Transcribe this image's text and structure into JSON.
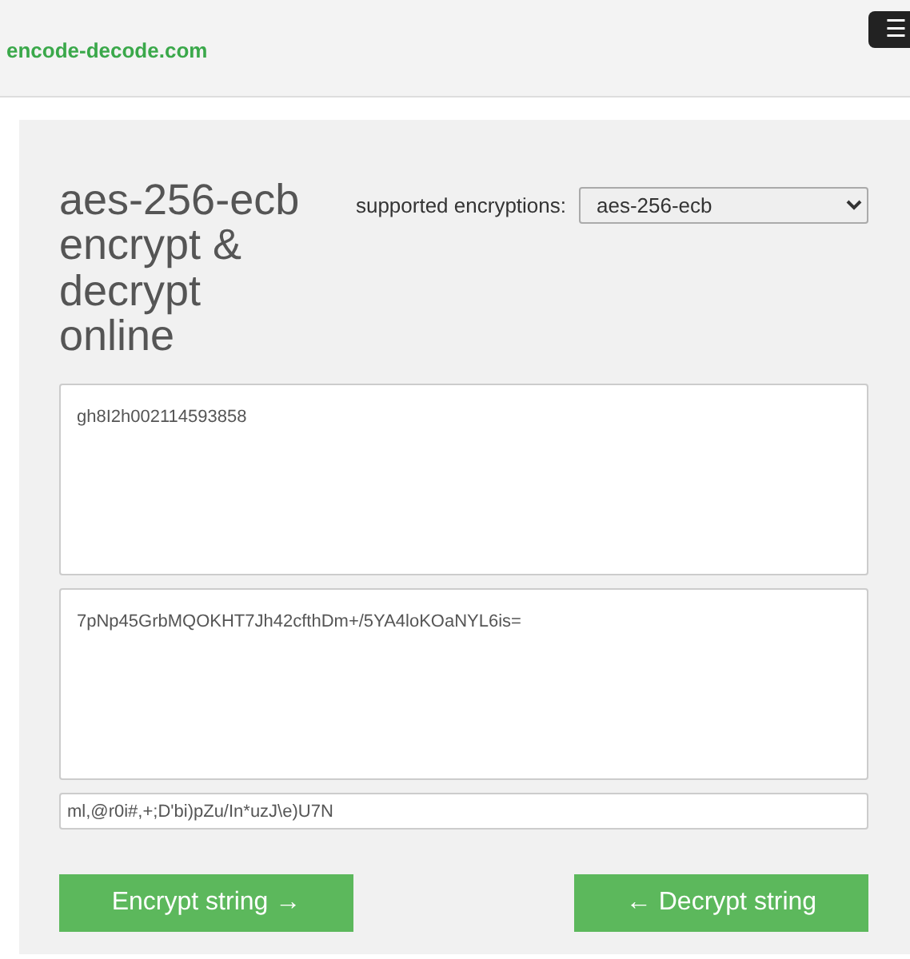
{
  "navbar": {
    "brand": "encode-decode.com",
    "menu_button": "☰"
  },
  "title": "aes-256-ecb encrypt & decrypt online",
  "encryption_select": {
    "label": "supported encryptions:",
    "value": "aes-256-ecb"
  },
  "plain_text": "gh8I2h002114593858",
  "encrypted_text": "7pNp45GrbMQOKHT7Jh42cfthDm+/5YA4loKOaNYL6is=",
  "key": "ml,@r0i#,+;D'bi)pZu/In*uzJ\\e)U7N",
  "buttons": [
    {
      "label": "Encrypt string →"
    },
    {
      "label": "← Decrypt string"
    }
  ]
}
